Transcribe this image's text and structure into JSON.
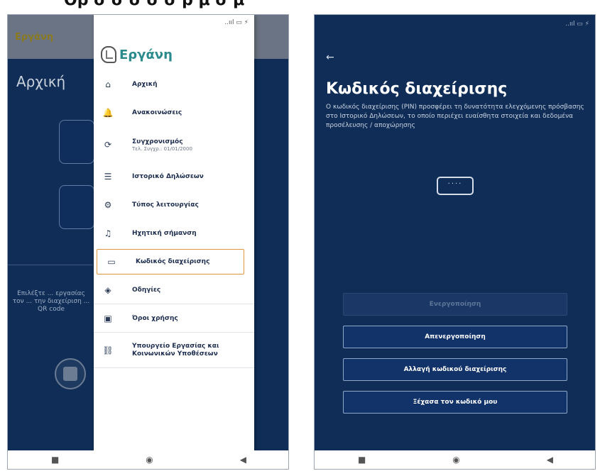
{
  "cutoff_title": "Ορ σ σ σ σ   σ ρ  μ σ μ",
  "left_screen": {
    "bg_app_name": "Εργάνη",
    "bg_page_title": "Αρχική",
    "bg_instructions": "Επιλέξτε ... εργασίας τον ... την διαχείριση ... QR code",
    "drawer": {
      "status": "..ııl ▭ ⚡",
      "app_name": "Εργάνη",
      "items": [
        {
          "label": "Αρχική",
          "icon": "home-icon",
          "glyph": "⌂"
        },
        {
          "label": "Ανακοινώσεις",
          "icon": "bell-icon",
          "glyph": "🔔"
        },
        {
          "label": "Συγχρονισμός",
          "sub": "Τελ. Συγχρ.: 01/01/2000",
          "icon": "sync-icon",
          "glyph": "⟳"
        },
        {
          "label": "Ιστορικό Δηλώσεων",
          "icon": "list-icon",
          "glyph": "☰"
        },
        {
          "label": "Τύπος λειτουργίας",
          "icon": "mode-icon",
          "glyph": "⚙"
        },
        {
          "label": "Ηχητική σήμανση",
          "icon": "music-icon",
          "glyph": "♫"
        },
        {
          "label": "Κωδικός διαχείρισης",
          "icon": "password-icon",
          "glyph": "▭"
        },
        {
          "label": "Οδηγίες",
          "icon": "help-icon",
          "glyph": "◈"
        },
        {
          "label": "Όροι χρήσης",
          "icon": "document-icon",
          "glyph": "▣"
        },
        {
          "label": "Υπουργείο Εργασίας και Κοινωνικών Υποθέσεων",
          "icon": "link-icon",
          "glyph": "⛓"
        }
      ]
    },
    "nav": {
      "recents": "■",
      "home": "◉",
      "back": "◀"
    }
  },
  "right_screen": {
    "status": "..ııl ▭ ⚡",
    "back": "←",
    "title": "Κωδικός διαχείρισης",
    "description": "Ο κωδικός διαχείρισης (PIN) προσφέρει τη δυνατότητα ελεγχόμενης πρόσβασης στο Ιστορικό Δηλώσεων, το οποίο περιέχει ευαίσθητα στοιχεία και δεδομένα προσέλευσης / αποχώρησης",
    "pin_value": "····",
    "buttons": {
      "activate": "Ενεργοποίηση",
      "deactivate": "Απενεργοποίηση",
      "change": "Αλλαγή κωδικού διαχείρισης",
      "forgot": "Ξέχασα τον κωδικό μου"
    },
    "nav": {
      "recents": "■",
      "home": "◉",
      "back": "◀"
    }
  }
}
